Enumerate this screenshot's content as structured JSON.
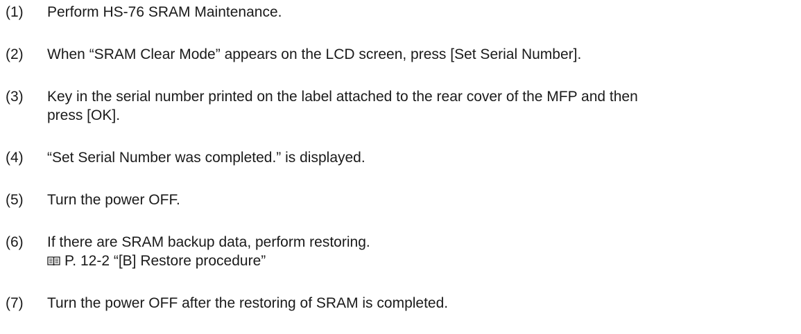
{
  "steps": [
    {
      "number": "(1)",
      "lines": [
        "Perform HS-76 SRAM Maintenance."
      ]
    },
    {
      "number": "(2)",
      "lines": [
        "When “SRAM Clear Mode” appears on the LCD screen, press [Set Serial Number]."
      ]
    },
    {
      "number": "(3)",
      "lines": [
        "Key in the serial number printed on the label attached to the rear cover of the MFP and then",
        "press [OK]."
      ]
    },
    {
      "number": "(4)",
      "lines": [
        "“Set Serial Number was completed.” is displayed."
      ]
    },
    {
      "number": "(5)",
      "lines": [
        "Turn the power OFF."
      ]
    },
    {
      "number": "(6)",
      "lines": [
        "If there are SRAM backup data, perform restoring."
      ],
      "reference": {
        "icon": "book-icon",
        "text": "P. 12-2 “[B] Restore procedure”"
      }
    },
    {
      "number": "(7)",
      "lines": [
        "Turn the power OFF after the restoring of SRAM is completed."
      ]
    }
  ]
}
